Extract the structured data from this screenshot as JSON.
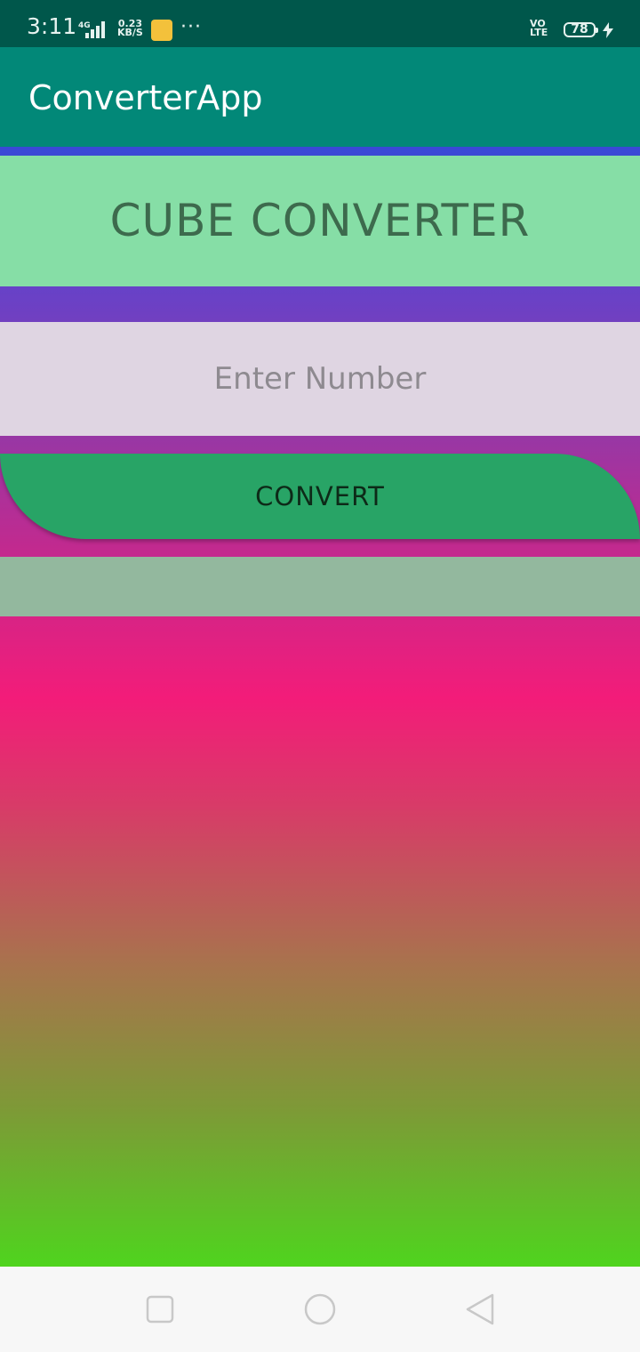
{
  "status_bar": {
    "time": "3:11",
    "network": "4G",
    "speed_value": "0.23",
    "speed_unit": "KB/S",
    "more": "···",
    "volte_top": "VO",
    "volte_bottom": "LTE",
    "battery": "78"
  },
  "app_bar": {
    "title": "ConverterApp"
  },
  "main": {
    "header": "CUBE CONVERTER",
    "input_placeholder": "Enter Number",
    "input_value": "",
    "convert_label": "CONVERT",
    "result": ""
  },
  "nav_bar": {
    "icons": [
      "recent-apps-icon",
      "home-icon",
      "back-icon"
    ]
  },
  "colors": {
    "status_bar": "#00574b",
    "app_bar": "#028878",
    "header_box": "#86dea6",
    "input_box": "#dfd5e2",
    "convert_button": "#28a466",
    "result_box": "#93b89e"
  }
}
